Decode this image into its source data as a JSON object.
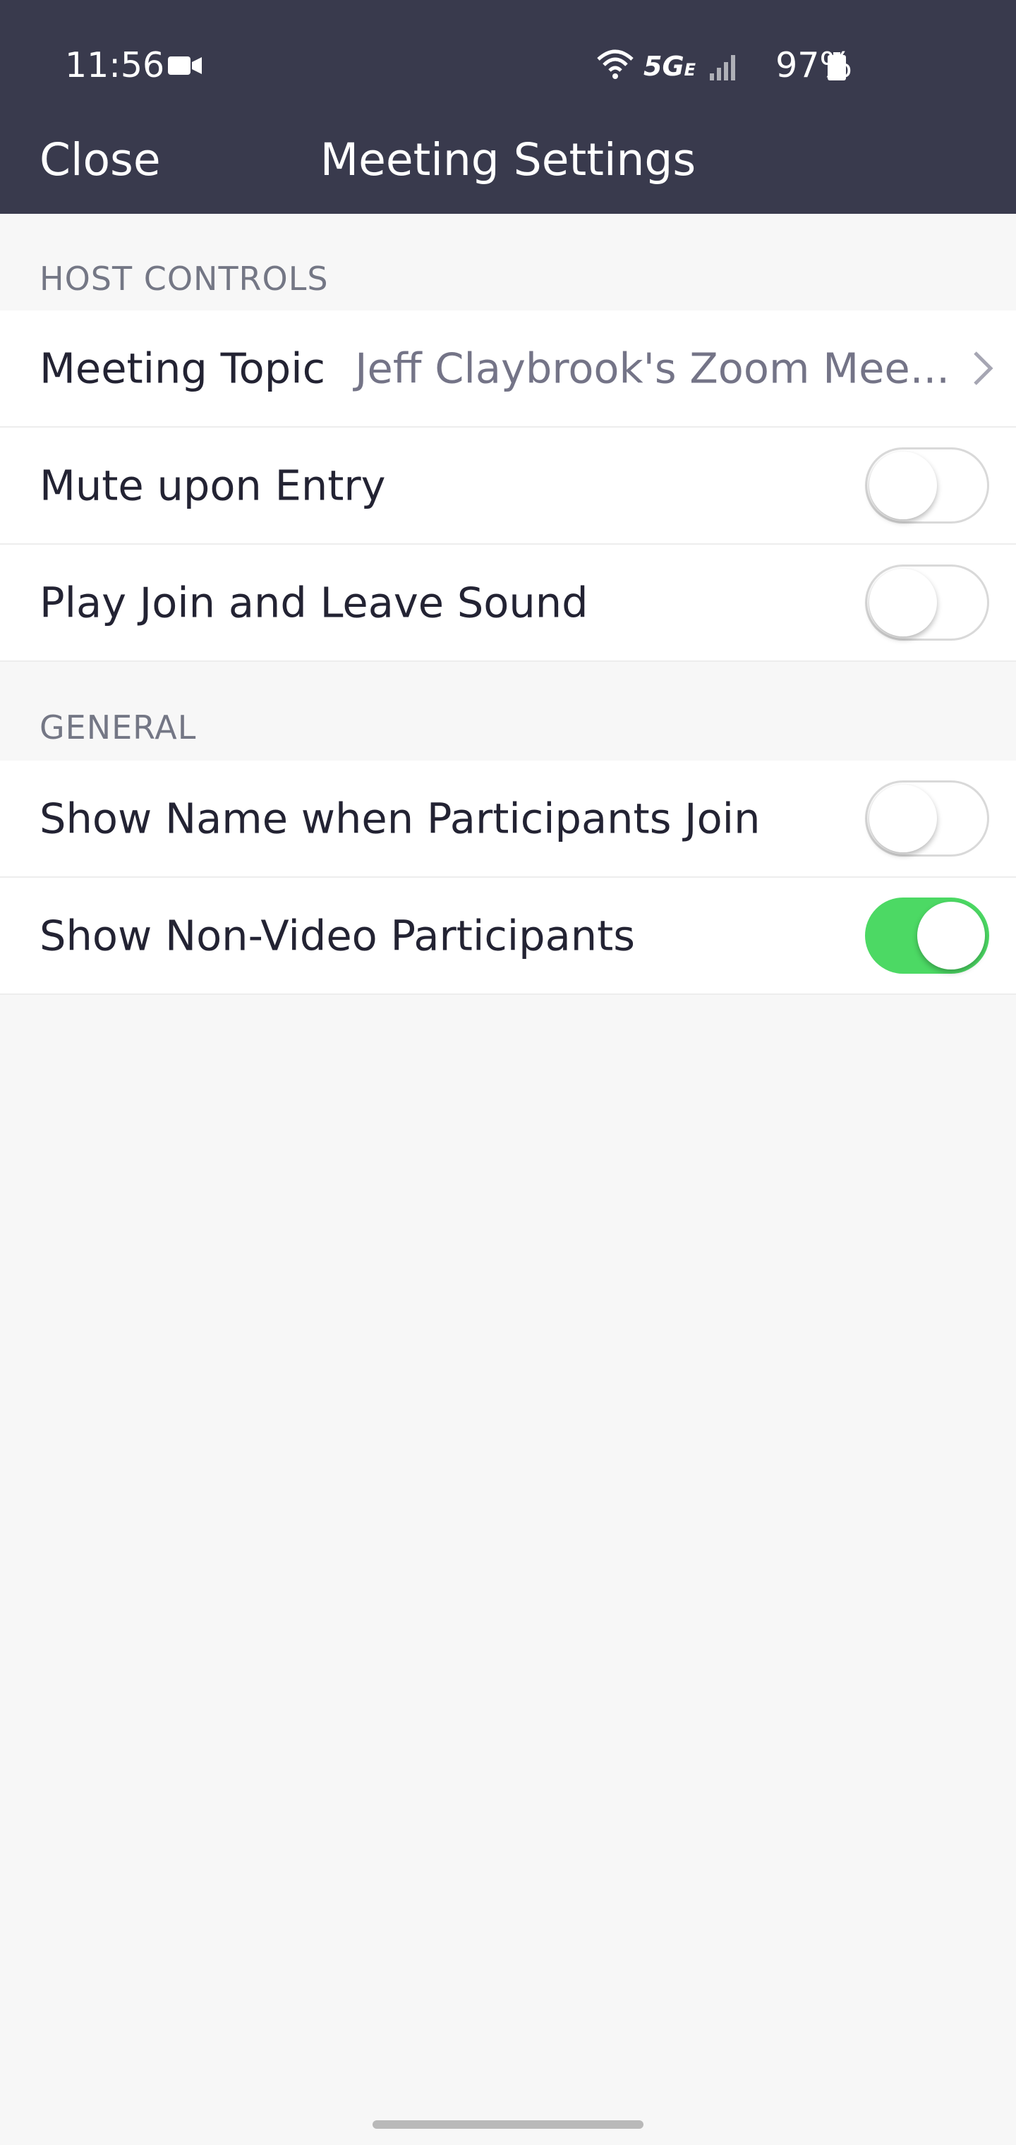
{
  "status_bar": {
    "time": "11:56",
    "network": "5G",
    "network_sub": "E",
    "battery": "97%",
    "icons": [
      "video-camera-icon",
      "wifi-icon",
      "signal-icon",
      "battery-icon"
    ]
  },
  "header": {
    "close_label": "Close",
    "title": "Meeting Settings"
  },
  "sections": {
    "host_controls": {
      "title": "HOST CONTROLS",
      "meeting_topic": {
        "label": "Meeting Topic",
        "value": "Jeff Claybrook's Zoom Mee..."
      },
      "mute_upon_entry": {
        "label": "Mute upon Entry",
        "enabled": false
      },
      "join_leave_sound": {
        "label": "Play Join and Leave Sound",
        "enabled": false
      }
    },
    "general": {
      "title": "GENERAL",
      "show_name_join": {
        "label": "Show Name when Participants Join",
        "enabled": false
      },
      "show_non_video": {
        "label": "Show Non-Video Participants",
        "enabled": true
      }
    }
  },
  "colors": {
    "header_bg": "#393a4d",
    "toggle_on": "#4cd964",
    "page_bg": "#f7f7f7"
  }
}
